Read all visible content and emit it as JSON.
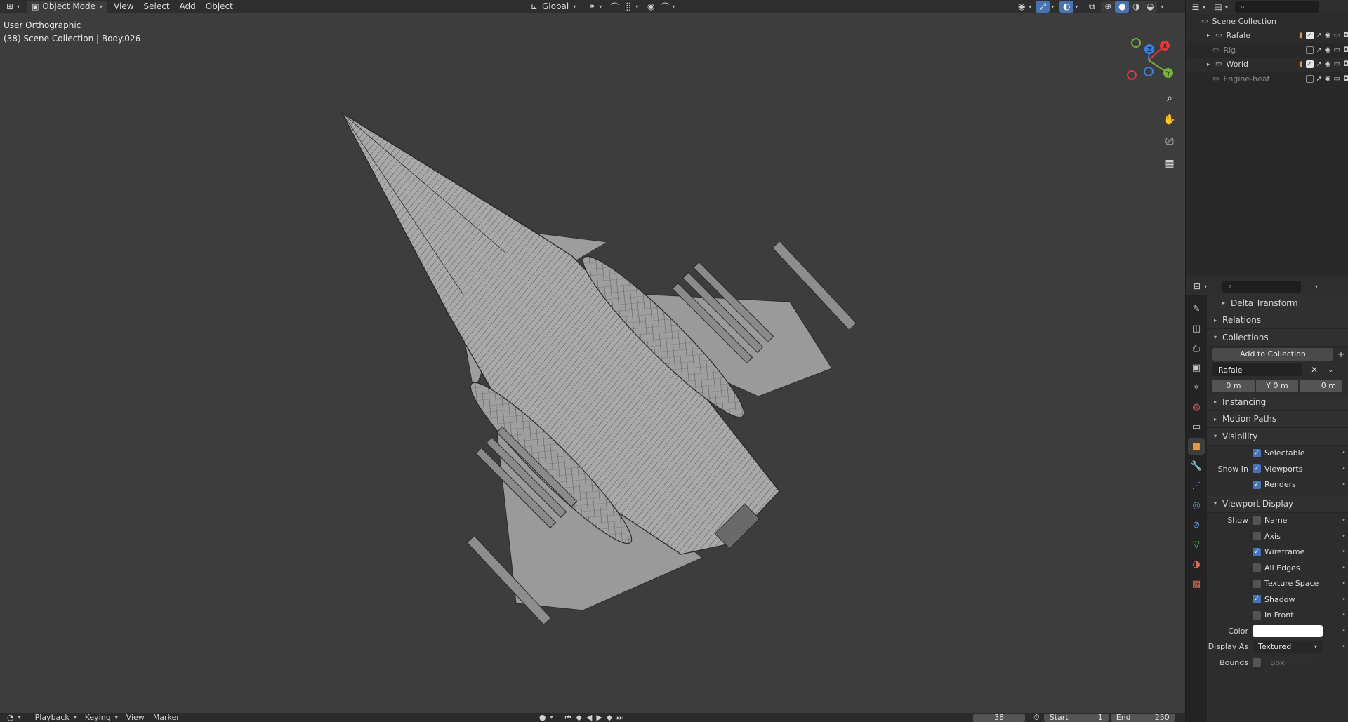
{
  "header": {
    "mode": "Object Mode",
    "menus": [
      "View",
      "Select",
      "Add",
      "Object"
    ],
    "orientation": "Global"
  },
  "viewport": {
    "view_name": "User Orthographic",
    "context": "(38) Scene Collection | Body.026",
    "gizmo": {
      "x": "X",
      "y": "Y",
      "z": "Z",
      "x_color": "#e0383d",
      "y_color": "#73b532",
      "z_color": "#3d7fe0"
    }
  },
  "outliner": {
    "search_placeholder": "",
    "root": "Scene Collection",
    "items": [
      {
        "name": "Rafale",
        "enabled": true,
        "expandable": true
      },
      {
        "name": "Rig",
        "enabled": false,
        "expandable": false
      },
      {
        "name": "World",
        "enabled": true,
        "expandable": true
      },
      {
        "name": "Engine-heat",
        "enabled": false,
        "expandable": false
      }
    ]
  },
  "properties": {
    "search_placeholder": "",
    "delta_transform": "Delta Transform",
    "relations": "Relations",
    "collections": "Collections",
    "add_to_collection": "Add to Collection",
    "collection_name": "Rafale",
    "offset": {
      "x": "0 m",
      "y": "Y  0 m",
      "z": "0 m"
    },
    "instancing": "Instancing",
    "motion_paths": "Motion Paths",
    "visibility": "Visibility",
    "selectable": "Selectable",
    "show_in": "Show In",
    "viewports": "Viewports",
    "renders": "Renders",
    "viewport_display": "Viewport Display",
    "show": "Show",
    "display_options": [
      {
        "label": "Name",
        "checked": false
      },
      {
        "label": "Axis",
        "checked": false
      },
      {
        "label": "Wireframe",
        "checked": true
      },
      {
        "label": "All Edges",
        "checked": false
      },
      {
        "label": "Texture Space",
        "checked": false
      },
      {
        "label": "Shadow",
        "checked": true
      },
      {
        "label": "In Front",
        "checked": false
      }
    ],
    "color_label": "Color",
    "display_as_label": "Display As",
    "display_as_value": "Textured",
    "bounds_label": "Bounds",
    "bounds_value": "Box"
  },
  "timeline": {
    "playback": "Playback",
    "keying": "Keying",
    "view": "View",
    "marker": "Marker",
    "current_frame": "38",
    "start_label": "Start",
    "start": "1",
    "end_label": "End",
    "end": "250"
  }
}
